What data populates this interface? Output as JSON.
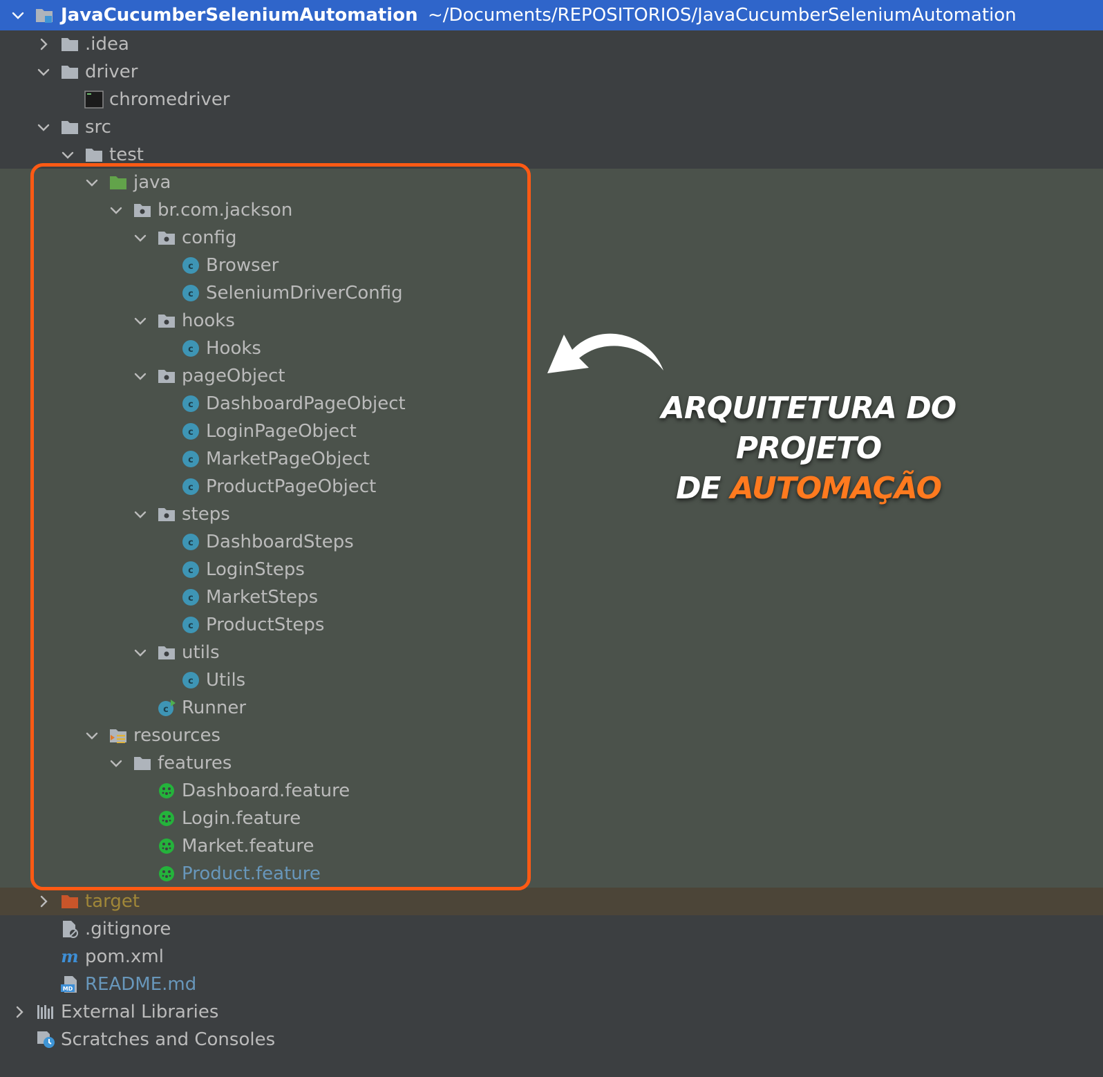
{
  "colors": {
    "accent": "#ff5a14",
    "selection": "#2f65ca",
    "test_root_bg": "#4b524b",
    "excluded_bg": "#4c4538",
    "caption_accent": "#ff7a1f"
  },
  "project": {
    "name": "JavaCucumberSeleniumAutomation",
    "path": "~/Documents/REPOSITORIOS/JavaCucumberSeleniumAutomation"
  },
  "tree": [
    {
      "label": ".idea",
      "icon": "folder-icon"
    },
    {
      "label": "driver",
      "icon": "folder-icon"
    },
    {
      "label": "chromedriver",
      "icon": "executable-file-icon"
    },
    {
      "label": "src",
      "icon": "folder-icon"
    },
    {
      "label": "test",
      "icon": "folder-icon"
    },
    {
      "label": "java",
      "icon": "test-source-folder-icon"
    },
    {
      "label": "br.com.jackson",
      "icon": "package-icon"
    },
    {
      "label": "config",
      "icon": "package-icon"
    },
    {
      "label": "Browser",
      "icon": "java-class-icon"
    },
    {
      "label": "SeleniumDriverConfig",
      "icon": "java-class-icon"
    },
    {
      "label": "hooks",
      "icon": "package-icon"
    },
    {
      "label": "Hooks",
      "icon": "java-class-icon"
    },
    {
      "label": "pageObject",
      "icon": "package-icon"
    },
    {
      "label": "DashboardPageObject",
      "icon": "java-class-icon"
    },
    {
      "label": "LoginPageObject",
      "icon": "java-class-icon"
    },
    {
      "label": "MarketPageObject",
      "icon": "java-class-icon"
    },
    {
      "label": "ProductPageObject",
      "icon": "java-class-icon"
    },
    {
      "label": "steps",
      "icon": "package-icon"
    },
    {
      "label": "DashboardSteps",
      "icon": "java-class-icon"
    },
    {
      "label": "LoginSteps",
      "icon": "java-class-icon"
    },
    {
      "label": "MarketSteps",
      "icon": "java-class-icon"
    },
    {
      "label": "ProductSteps",
      "icon": "java-class-icon"
    },
    {
      "label": "utils",
      "icon": "package-icon"
    },
    {
      "label": "Utils",
      "icon": "java-class-icon"
    },
    {
      "label": "Runner",
      "icon": "java-runnable-class-icon"
    },
    {
      "label": "resources",
      "icon": "resources-folder-icon"
    },
    {
      "label": "features",
      "icon": "folder-icon"
    },
    {
      "label": "Dashboard.feature",
      "icon": "cucumber-icon"
    },
    {
      "label": "Login.feature",
      "icon": "cucumber-icon"
    },
    {
      "label": "Market.feature",
      "icon": "cucumber-icon"
    },
    {
      "label": "Product.feature",
      "icon": "cucumber-icon"
    },
    {
      "label": "target",
      "icon": "excluded-folder-icon"
    },
    {
      "label": ".gitignore",
      "icon": "ignore-file-icon"
    },
    {
      "label": "pom.xml",
      "icon": "maven-icon"
    },
    {
      "label": "README.md",
      "icon": "markdown-icon"
    },
    {
      "label": "External Libraries",
      "icon": "libraries-icon"
    },
    {
      "label": "Scratches and Consoles",
      "icon": "scratches-icon"
    }
  ],
  "annotation": {
    "line1": "ARQUITETURA DO PROJETO",
    "line2_prefix": "DE ",
    "line2_accent": "AUTOMAÇÃO"
  }
}
